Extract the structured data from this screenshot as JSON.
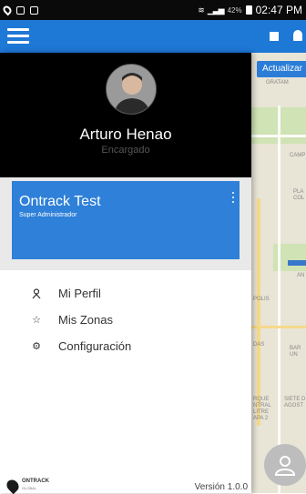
{
  "status_bar": {
    "battery_percent": "42%",
    "time": "02:47 PM"
  },
  "map": {
    "update_button": "Actualizar",
    "labels": [
      "GRATAM",
      "CAMP",
      "PLA COL",
      "AN",
      "POLIS",
      "DAS",
      "BAR UN",
      "RQUE NTRAL LITRE APA 2",
      "SIETE D AGOST"
    ]
  },
  "drawer": {
    "user": {
      "name": "Arturo Henao",
      "role": "Encargado"
    },
    "organization": {
      "name": "Ontrack Test",
      "role": "Super Administrador"
    },
    "menu": [
      {
        "icon": "person-icon",
        "label": "Mi Perfil"
      },
      {
        "icon": "star-icon",
        "label": "Mis Zonas"
      },
      {
        "icon": "gear-icon",
        "label": "Configuración"
      }
    ],
    "footer": {
      "logo_text": "ONTRACK",
      "logo_sub": "GLOBAL",
      "version": "Versión 1.0.0"
    }
  },
  "colors": {
    "primary": "#1e78d6",
    "card": "#2e80d8",
    "profile_bg": "#000000"
  }
}
